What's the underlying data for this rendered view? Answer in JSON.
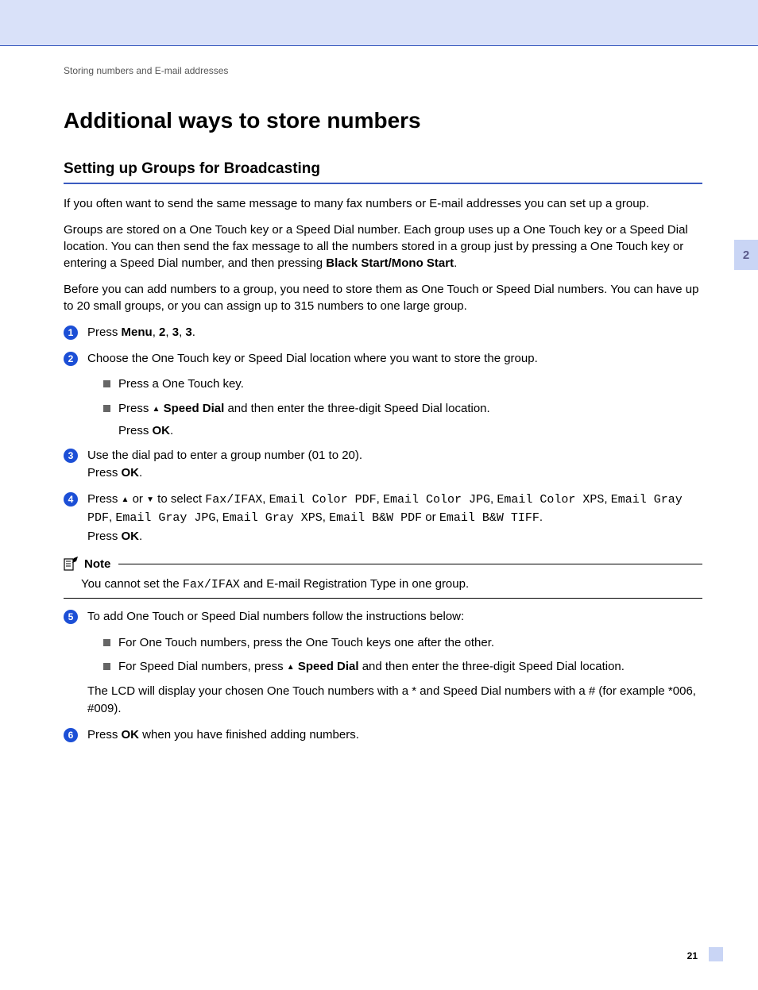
{
  "header": "Storing numbers and E-mail addresses",
  "h1": "Additional ways to store numbers",
  "h2": "Setting up Groups for Broadcasting",
  "side_tab": "2",
  "page_number": "21",
  "para1": "If you often want to send the same message to many fax numbers or E-mail addresses you can set up a group.",
  "para2_a": "Groups are stored on a One Touch key or a Speed Dial number. Each group uses up a One Touch key or a Speed Dial location. You can then send the fax message to all the numbers stored in a group just by pressing a One Touch key or entering a Speed Dial number, and then pressing ",
  "para2_b": "Black Start/Mono Start",
  "para2_c": ".",
  "para3": "Before you can add numbers to a group, you need to store them as One Touch or Speed Dial numbers. You can have up to 20 small groups, or you can assign up to 315 numbers to one large group.",
  "step1_a": "Press ",
  "step1_b": "Menu",
  "step1_c": ", ",
  "step1_d": "2",
  "step1_e": ", ",
  "step1_f": "3",
  "step1_g": ", ",
  "step1_h": "3",
  "step1_i": ".",
  "step2": "Choose the One Touch key or Speed Dial location where you want to store the group.",
  "step2_sub1": "Press a One Touch key.",
  "step2_sub2_a": "Press ",
  "step2_sub2_b": " Speed Dial",
  "step2_sub2_c": " and then enter the three-digit Speed Dial location.",
  "step2_sub2_press_a": "Press ",
  "step2_sub2_press_b": "OK",
  "step2_sub2_press_c": ".",
  "step3_a": "Use the dial pad to enter a group number (01 to 20).",
  "step3_b": "Press ",
  "step3_c": "OK",
  "step3_d": ".",
  "step4_a": "Press ",
  "step4_b": " or ",
  "step4_c": " to select ",
  "step4_opts": {
    "o1": "Fax/IFAX",
    "s1": ", ",
    "o2": "Email Color PDF",
    "s2": ", ",
    "o3": "Email Color JPG",
    "s3": ", ",
    "o4": "Email Color XPS",
    "s4": ", ",
    "o5": "Email Gray PDF",
    "s5": ", ",
    "o6": "Email Gray JPG",
    "s6": ", ",
    "o7": "Email Gray XPS",
    "s7": ", ",
    "o8": "Email B&W PDF",
    "s8": " or ",
    "o9": "Email B&W TIFF",
    "s9": "."
  },
  "step4_press_a": "Press ",
  "step4_press_b": "OK",
  "step4_press_c": ".",
  "note_title": "Note",
  "note_body_a": "You cannot set the ",
  "note_body_b": "Fax/IFAX",
  "note_body_c": " and E-mail Registration Type in one group.",
  "step5": "To add One Touch or Speed Dial numbers follow the instructions below:",
  "step5_sub1": "For One Touch numbers, press the One Touch keys one after the other.",
  "step5_sub2_a": "For Speed Dial numbers, press ",
  "step5_sub2_b": " Speed Dial",
  "step5_sub2_c": " and then enter the three-digit Speed Dial location.",
  "step5_tail": "The LCD will display your chosen One Touch numbers with a * and Speed Dial numbers with a # (for example *006, #009).",
  "step6_a": "Press ",
  "step6_b": "OK",
  "step6_c": " when you have finished adding numbers."
}
